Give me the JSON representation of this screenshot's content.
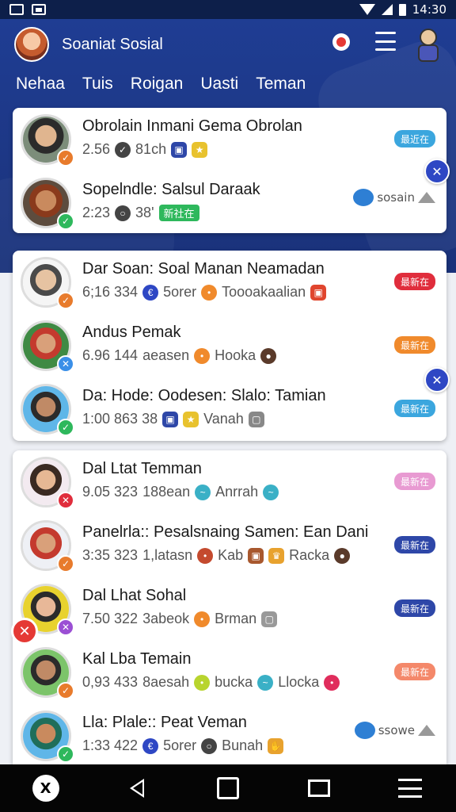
{
  "status_bar": {
    "time": "14:30"
  },
  "header": {
    "title": "Soaniat Sosial",
    "tabs": [
      "Nehaa",
      "Tuis",
      "Roigan",
      "Uasti",
      "Teman"
    ]
  },
  "card1": [
    {
      "name": "Obrolain Inmani Gema Obrolan",
      "meta": "2.56",
      "meta2": "81ch",
      "pill": "最近在",
      "pill_color": "#3ba6de",
      "check_color": "#e87b2c",
      "check": "✓"
    },
    {
      "name": "Sopelndle: Salsul Daraak",
      "meta": "2:23",
      "meta2": "38'",
      "chip": "新社在",
      "share_label": "sosain",
      "check_color": "#2eb85c",
      "check": "✓"
    }
  ],
  "card2": [
    {
      "name": "Dar Soan: Soal Manan Neamadan",
      "meta": "6;16 334",
      "meta2": "5orer",
      "meta3": "Toooakaalian",
      "pill": "最新在",
      "pill_color": "#e02d3c",
      "check_color": "#e87b2c",
      "check": "✓"
    },
    {
      "name": "Andus Pemak",
      "meta": "6.96 144",
      "meta2": "aeasen",
      "meta3": "Hooka",
      "pill": "最新在",
      "pill_color": "#f08a2c",
      "check_color": "#3a8fe8",
      "check": "✕"
    },
    {
      "name": "Da: Hode: Oodesen: Slalo: Tamian",
      "meta": "1:00 863 38",
      "meta3": "Vanah",
      "pill": "最新在",
      "pill_color": "#3ba6de",
      "check_color": "#2eb85c",
      "check": "✓"
    }
  ],
  "card3": [
    {
      "name": "Dal Ltat Temman",
      "meta": "9.05 323",
      "meta2": "188ean",
      "meta3": "Anrrah",
      "pill": "最新在",
      "pill_color": "#e89ad2",
      "check_color": "#e02d3c",
      "check": "✕"
    },
    {
      "name": "Panelrla:: Pesalsnaing Samen: Ean Dani",
      "meta": "3:35 323",
      "meta2": "1,latasn",
      "meta3": "Kab",
      "meta4": "Racka",
      "pill": "最新在",
      "pill_color": "#2e47a8",
      "check_color": "#e87b2c",
      "check": "✓"
    },
    {
      "name": "Dal Lhat Sohal",
      "meta": "7.50 322",
      "meta2": "3abeok",
      "meta3": "Brman",
      "pill": "最新在",
      "pill_color": "#2e47a8",
      "check_color": "#9b4fd4",
      "check": "✕"
    },
    {
      "name": "Kal Lba Temain",
      "meta": "0,93 433",
      "meta2": "8aesah",
      "meta3": "bucka",
      "meta4": "Llocka",
      "pill": "最新在",
      "pill_color": "#f4886a",
      "check_color": "#e87b2c",
      "check": "✓"
    },
    {
      "name": "Lla: Plale:: Peat Veman",
      "meta": "1:33 422",
      "meta2": "5orer",
      "meta3": "Bunah",
      "share_label": "ssowe",
      "check_color": "#2eb85c",
      "check": "✓"
    }
  ],
  "icons": {
    "float_action": "shuffle-icon",
    "remove": "close-icon"
  }
}
